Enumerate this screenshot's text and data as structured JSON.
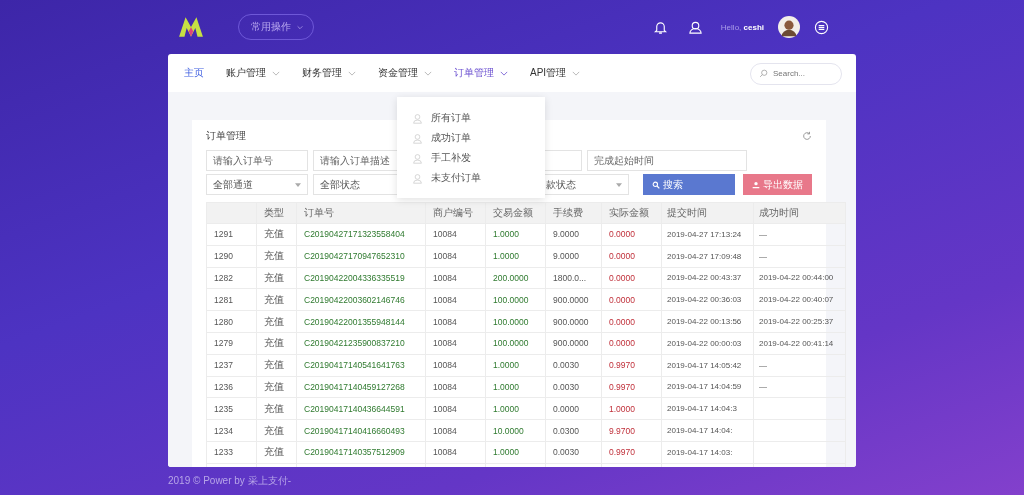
{
  "header": {
    "quick_menu": "常用操作",
    "greeting": "Hello,",
    "username": "ceshi"
  },
  "nav": {
    "items": [
      {
        "label": "主页",
        "selected": true,
        "has_menu": false,
        "expanded": false
      },
      {
        "label": "账户管理",
        "selected": false,
        "has_menu": true,
        "expanded": false
      },
      {
        "label": "财务管理",
        "selected": false,
        "has_menu": true,
        "expanded": false
      },
      {
        "label": "资金管理",
        "selected": false,
        "has_menu": true,
        "expanded": false
      },
      {
        "label": "订单管理",
        "selected": false,
        "has_menu": true,
        "expanded": true
      },
      {
        "label": "API管理",
        "selected": false,
        "has_menu": true,
        "expanded": false
      }
    ],
    "search_placeholder": "Search..."
  },
  "dropdown": {
    "items": [
      "所有订单",
      "成功订单",
      "手工补发",
      "未支付订单"
    ]
  },
  "panel": {
    "title": "订单管理"
  },
  "filters": {
    "row_1": [
      {
        "kind": "input",
        "placeholder": "请输入订单号"
      },
      {
        "kind": "input",
        "placeholder": "请输入订单描述"
      },
      {
        "kind": "input"
      },
      {
        "kind": "input",
        "placeholder": "完成起始时间"
      }
    ],
    "row_2": [
      {
        "kind": "select",
        "value": "全部通道"
      },
      {
        "kind": "select",
        "value": "全部状态"
      },
      {
        "kind": "select",
        "value": "款状态"
      }
    ],
    "buttons": [
      {
        "kind": "search",
        "label": "搜索"
      },
      {
        "kind": "export",
        "label": "导出数据"
      }
    ]
  },
  "table": {
    "columns": [
      "",
      "类型",
      "订单号",
      "商户编号",
      "交易金额",
      "手续费",
      "实际金额",
      "提交时间",
      "成功时间"
    ],
    "rows": [
      [
        "1291",
        "充值",
        "C20190427171323558404",
        "10084",
        "1.0000",
        "9.0000",
        "0.0000",
        "2019-04-27 17:13:24",
        "—"
      ],
      [
        "1290",
        "充值",
        "C20190427170947652310",
        "10084",
        "1.0000",
        "9.0000",
        "0.0000",
        "2019-04-27 17:09:48",
        "—"
      ],
      [
        "1282",
        "充值",
        "C20190422004336335519",
        "10084",
        "200.0000",
        "1800.0...",
        "0.0000",
        "2019-04-22 00:43:37",
        "2019-04-22 00:44:00"
      ],
      [
        "1281",
        "充值",
        "C20190422003602146746",
        "10084",
        "100.0000",
        "900.0000",
        "0.0000",
        "2019-04-22 00:36:03",
        "2019-04-22 00:40:07"
      ],
      [
        "1280",
        "充值",
        "C20190422001355948144",
        "10084",
        "100.0000",
        "900.0000",
        "0.0000",
        "2019-04-22 00:13:56",
        "2019-04-22 00:25:37"
      ],
      [
        "1279",
        "充值",
        "C20190421235900837210",
        "10084",
        "100.0000",
        "900.0000",
        "0.0000",
        "2019-04-22 00:00:03",
        "2019-04-22 00:41:14"
      ],
      [
        "1237",
        "充值",
        "C20190417140541641763",
        "10084",
        "1.0000",
        "0.0030",
        "0.9970",
        "2019-04-17 14:05:42",
        "—"
      ],
      [
        "1236",
        "充值",
        "C20190417140459127268",
        "10084",
        "1.0000",
        "0.0030",
        "0.9970",
        "2019-04-17 14:04:59",
        "—"
      ],
      [
        "1235",
        "充值",
        "C20190417140436644591",
        "10084",
        "1.0000",
        "0.0000",
        "1.0000",
        "2019-04-17 14:04:3"
      ],
      [
        "1234",
        "充值",
        "C20190417140416660493",
        "10084",
        "10.0000",
        "0.0300",
        "9.9700",
        "2019-04-17 14:04:"
      ],
      [
        "1233",
        "充值",
        "C20190417140357512909",
        "10084",
        "1.0000",
        "0.0030",
        "0.9970",
        "2019-04-17 14:03:"
      ]
    ]
  },
  "footer": "2019 © Power by 采上支付-"
}
